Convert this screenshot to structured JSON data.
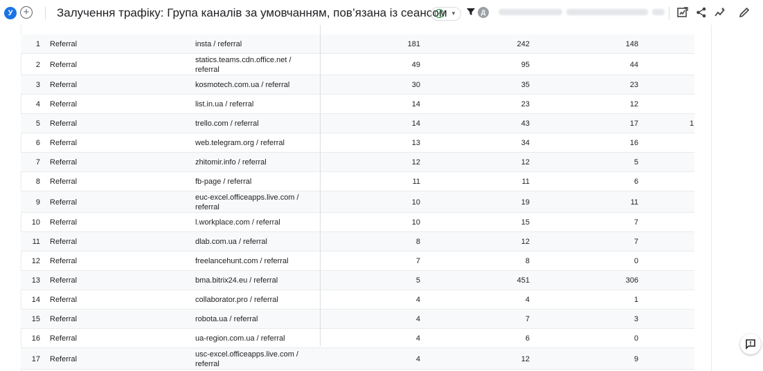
{
  "header": {
    "avatar_letter": "У",
    "add_comparison_symbol": "+",
    "title": "Залучення трафіку: Група каналів за умовчанням, пов’язана із сеансом",
    "user_avatar_letter": "Д"
  },
  "table": {
    "rows": [
      {
        "idx": "1",
        "group": "Referral",
        "source": "insta / referral",
        "v1": "181",
        "v2": "242",
        "v3": "148",
        "v4": ""
      },
      {
        "idx": "2",
        "group": "Referral",
        "source": "statics.teams.cdn.office.net / referral",
        "v1": "49",
        "v2": "95",
        "v3": "44",
        "v4": ""
      },
      {
        "idx": "3",
        "group": "Referral",
        "source": "kosmotech.com.ua / referral",
        "v1": "30",
        "v2": "35",
        "v3": "23",
        "v4": ""
      },
      {
        "idx": "4",
        "group": "Referral",
        "source": "list.in.ua / referral",
        "v1": "14",
        "v2": "23",
        "v3": "12",
        "v4": ""
      },
      {
        "idx": "5",
        "group": "Referral",
        "source": "trello.com / referral",
        "v1": "14",
        "v2": "43",
        "v3": "17",
        "v4": "1"
      },
      {
        "idx": "6",
        "group": "Referral",
        "source": "web.telegram.org / referral",
        "v1": "13",
        "v2": "34",
        "v3": "16",
        "v4": ""
      },
      {
        "idx": "7",
        "group": "Referral",
        "source": "zhitomir.info / referral",
        "v1": "12",
        "v2": "12",
        "v3": "5",
        "v4": ""
      },
      {
        "idx": "8",
        "group": "Referral",
        "source": "fb-page / referral",
        "v1": "11",
        "v2": "11",
        "v3": "6",
        "v4": ""
      },
      {
        "idx": "9",
        "group": "Referral",
        "source": "euc-excel.officeapps.live.com / referral",
        "v1": "10",
        "v2": "19",
        "v3": "11",
        "v4": ""
      },
      {
        "idx": "10",
        "group": "Referral",
        "source": "l.workplace.com / referral",
        "v1": "10",
        "v2": "15",
        "v3": "7",
        "v4": ""
      },
      {
        "idx": "11",
        "group": "Referral",
        "source": "dlab.com.ua / referral",
        "v1": "8",
        "v2": "12",
        "v3": "7",
        "v4": ""
      },
      {
        "idx": "12",
        "group": "Referral",
        "source": "freelancehunt.com / referral",
        "v1": "7",
        "v2": "8",
        "v3": "0",
        "v4": ""
      },
      {
        "idx": "13",
        "group": "Referral",
        "source": "bma.bitrix24.eu / referral",
        "v1": "5",
        "v2": "451",
        "v3": "306",
        "v4": ""
      },
      {
        "idx": "14",
        "group": "Referral",
        "source": "collaborator.pro / referral",
        "v1": "4",
        "v2": "4",
        "v3": "1",
        "v4": ""
      },
      {
        "idx": "15",
        "group": "Referral",
        "source": "robota.ua / referral",
        "v1": "4",
        "v2": "7",
        "v3": "3",
        "v4": ""
      },
      {
        "idx": "16",
        "group": "Referral",
        "source": "ua-region.com.ua / referral",
        "v1": "4",
        "v2": "6",
        "v3": "0",
        "v4": ""
      },
      {
        "idx": "17",
        "group": "Referral",
        "source": "usc-excel.officeapps.live.com / referral",
        "v1": "4",
        "v2": "12",
        "v3": "9",
        "v4": ""
      }
    ]
  },
  "icons": {
    "verified": "check-circle-icon",
    "filter": "filter-icon",
    "edit_report": "edit-report-icon",
    "share": "share-icon",
    "insights": "insights-icon",
    "customize": "pencil-icon",
    "feedback": "feedback-icon"
  },
  "colors": {
    "accent": "#1a73e8",
    "verified": "#188038",
    "row_alt": "#f8f9fa"
  }
}
